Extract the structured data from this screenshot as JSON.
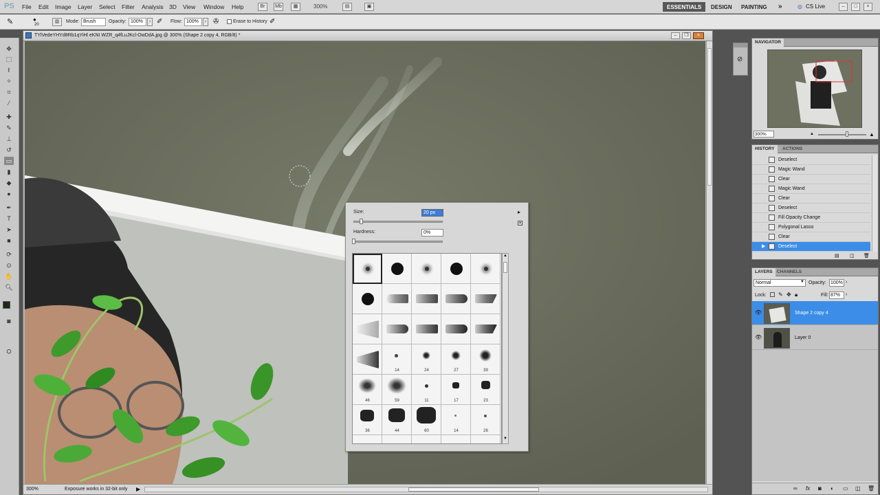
{
  "app": {
    "logo": "PS"
  },
  "menu": [
    "File",
    "Edit",
    "Image",
    "Layer",
    "Select",
    "Filter",
    "Analysis",
    "3D",
    "View",
    "Window",
    "Help"
  ],
  "appbar": {
    "zoom": "300%"
  },
  "workspaces": [
    "ESSENTIALS",
    "DESIGN",
    "PAINTING"
  ],
  "cslive": "CS Live",
  "options": {
    "brush_size": "20",
    "mode_label": "Mode:",
    "mode_value": "Brush",
    "opacity_label": "Opacity:",
    "opacity_value": "100%",
    "flow_label": "Flow:",
    "flow_value": "100%",
    "erase_label": "Erase to History"
  },
  "document": {
    "title": "TYlVedeYHYd8Rb1qYiHl eKNI WZR_q4fLuJKcl-OwDdA.jpg @ 300% (Shape 2 copy 4, RGB/8) *",
    "status_zoom": "300%",
    "status_text": "Exposure works in 32-bit only"
  },
  "brush_picker": {
    "size_label": "Size:",
    "size_value": "20 px",
    "hardness_label": "Hardness:",
    "hardness_value": "0%",
    "numbers": [
      "14",
      "24",
      "27",
      "39",
      "46",
      "59",
      "11",
      "17",
      "23",
      "36",
      "44",
      "60",
      "14",
      "26"
    ]
  },
  "navigator": {
    "title": "NAVIGATOR",
    "zoom": "300%"
  },
  "history": {
    "tabs": [
      "HISTORY",
      "ACTIONS"
    ],
    "items": [
      "Deselect",
      "Magic Wand",
      "Clear",
      "Magic Wand",
      "Clear",
      "Deselect",
      "Fill Opacity Change",
      "Polygonal Lasso",
      "Clear",
      "Deselect"
    ]
  },
  "layers": {
    "tabs": [
      "LAYERS",
      "CHANNELS"
    ],
    "blend_mode": "Normal",
    "opacity_label": "Opacity:",
    "opacity_value": "100%",
    "lock_label": "Lock:",
    "fill_label": "Fill:",
    "fill_value": "87%",
    "items": [
      "Shape 2 copy 4",
      "Layer 0"
    ]
  },
  "colors": {
    "accent": "#3b8de8",
    "canvas": "#6c6e5e"
  }
}
